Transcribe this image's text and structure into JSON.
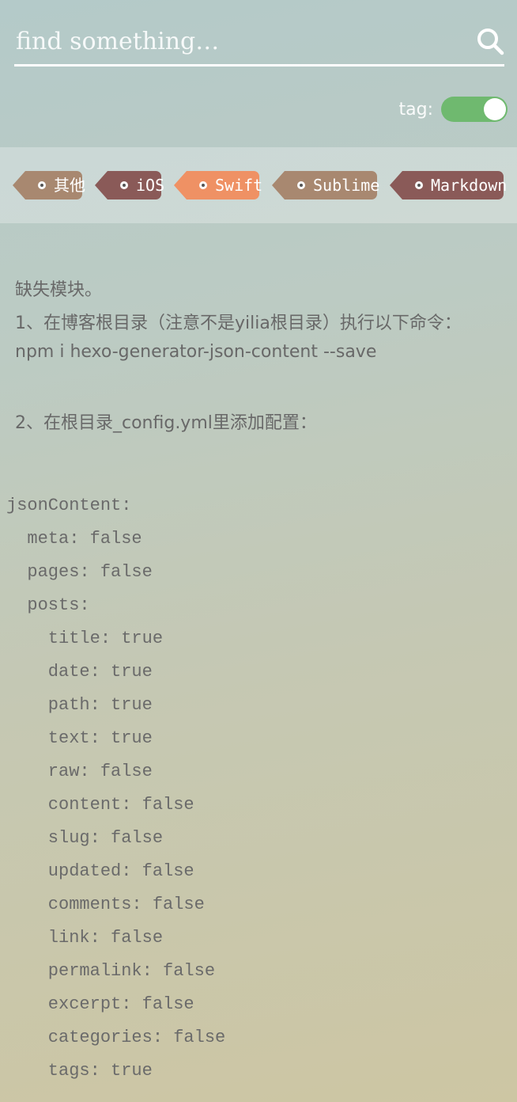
{
  "search": {
    "placeholder": "find something…"
  },
  "tag_toggle": {
    "label": "tag:",
    "on": true,
    "color": "#6fb96f"
  },
  "tags": [
    {
      "label": "其他",
      "color": "#a88870"
    },
    {
      "label": "iOS",
      "color": "#8a5a58"
    },
    {
      "label": "Swift",
      "color": "#ef9164"
    },
    {
      "label": "Sublime",
      "color": "#a88870"
    },
    {
      "label": "Markdown",
      "color": "#8a5a58"
    }
  ],
  "article": {
    "lines": [
      "缺失模块。",
      "1、在博客根目录（注意不是yilia根目录）执行以下命令：",
      "npm i hexo-generator-json-content --save",
      "2、在根目录_config.yml里添加配置："
    ],
    "code": [
      "jsonContent:",
      "  meta: false",
      "  pages: false",
      "  posts:",
      "    title: true",
      "    date: true",
      "    path: true",
      "    text: true",
      "    raw: false",
      "    content: false",
      "    slug: false",
      "    updated: false",
      "    comments: false",
      "    link: false",
      "    permalink: false",
      "    excerpt: false",
      "    categories: false",
      "    tags: true"
    ]
  }
}
